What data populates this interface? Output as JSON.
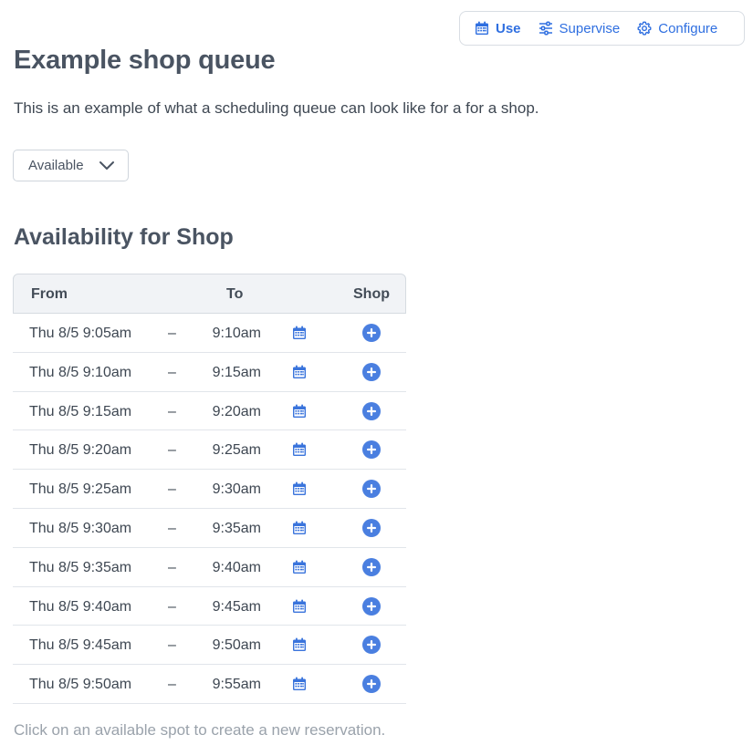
{
  "mode_tabs": [
    {
      "label": "Use",
      "icon": "calendar-icon",
      "active": true
    },
    {
      "label": "Supervise",
      "icon": "sliders-icon",
      "active": false
    },
    {
      "label": "Configure",
      "icon": "gear-icon",
      "active": false
    }
  ],
  "page": {
    "title": "Example shop queue",
    "description": "This is an example of what a scheduling queue can look like for a for a shop."
  },
  "status_select": {
    "value": "Available"
  },
  "availability": {
    "title": "Availability for Shop",
    "columns": {
      "from": "From",
      "to": "To",
      "shop": "Shop"
    },
    "rows": [
      {
        "from": "Thu 8/5 9:05am",
        "dash": "–",
        "to": "9:10am"
      },
      {
        "from": "Thu 8/5 9:10am",
        "dash": "–",
        "to": "9:15am"
      },
      {
        "from": "Thu 8/5 9:15am",
        "dash": "–",
        "to": "9:20am"
      },
      {
        "from": "Thu 8/5 9:20am",
        "dash": "–",
        "to": "9:25am"
      },
      {
        "from": "Thu 8/5 9:25am",
        "dash": "–",
        "to": "9:30am"
      },
      {
        "from": "Thu 8/5 9:30am",
        "dash": "–",
        "to": "9:35am"
      },
      {
        "from": "Thu 8/5 9:35am",
        "dash": "–",
        "to": "9:40am"
      },
      {
        "from": "Thu 8/5 9:40am",
        "dash": "–",
        "to": "9:45am"
      },
      {
        "from": "Thu 8/5 9:45am",
        "dash": "–",
        "to": "9:50am"
      },
      {
        "from": "Thu 8/5 9:50am",
        "dash": "–",
        "to": "9:55am"
      }
    ],
    "footnote": "Click on an available spot to create a new reservation."
  },
  "colors": {
    "accent": "#2f6fe0",
    "add_button": "#4a7fe0",
    "text": "#4a5462",
    "muted": "#9aa2ab"
  }
}
